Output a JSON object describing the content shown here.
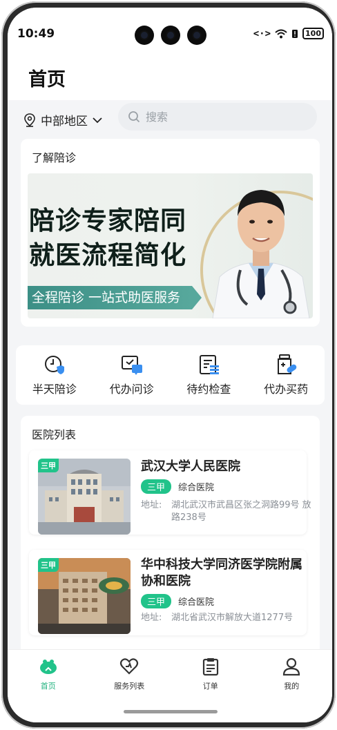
{
  "status_bar": {
    "time": "10:49",
    "battery": "100"
  },
  "header": {
    "title": "首页"
  },
  "location": {
    "label": "中部地区"
  },
  "search": {
    "placeholder": "搜索"
  },
  "learn": {
    "title": "了解陪诊",
    "banner": {
      "headline_1": "陪诊专家陪同",
      "headline_2": "就医流程简化",
      "ribbon": "全程陪诊 一站式助医服务"
    }
  },
  "services": [
    {
      "label": "半天陪诊",
      "icon": "clock-shield-icon"
    },
    {
      "label": "代办问诊",
      "icon": "chat-consult-icon"
    },
    {
      "label": "待约检查",
      "icon": "report-list-icon"
    },
    {
      "label": "代办买药",
      "icon": "medicine-bottle-icon"
    }
  ],
  "hospital_list": {
    "title": "医院列表",
    "items": [
      {
        "badge": "三甲",
        "name": "武汉大学人民医院",
        "level": "三甲",
        "type": "综合医院",
        "address_label": "地址:",
        "address": "湖北武汉市武昌区张之洞路99号 放路238号"
      },
      {
        "badge": "三甲",
        "name": "华中科技大学同济医学院附属协和医院",
        "level": "三甲",
        "type": "综合医院",
        "address_label": "地址:",
        "address": "湖北省武汉市解放大道1277号"
      }
    ]
  },
  "tabbar": [
    {
      "label": "首页",
      "icon": "home-icon",
      "active": true
    },
    {
      "label": "服务列表",
      "icon": "heart-icon",
      "active": false
    },
    {
      "label": "订单",
      "icon": "clipboard-icon",
      "active": false
    },
    {
      "label": "我的",
      "icon": "user-icon",
      "active": false
    }
  ],
  "colors": {
    "accent": "#21c38a",
    "background": "#f4f5f7"
  }
}
